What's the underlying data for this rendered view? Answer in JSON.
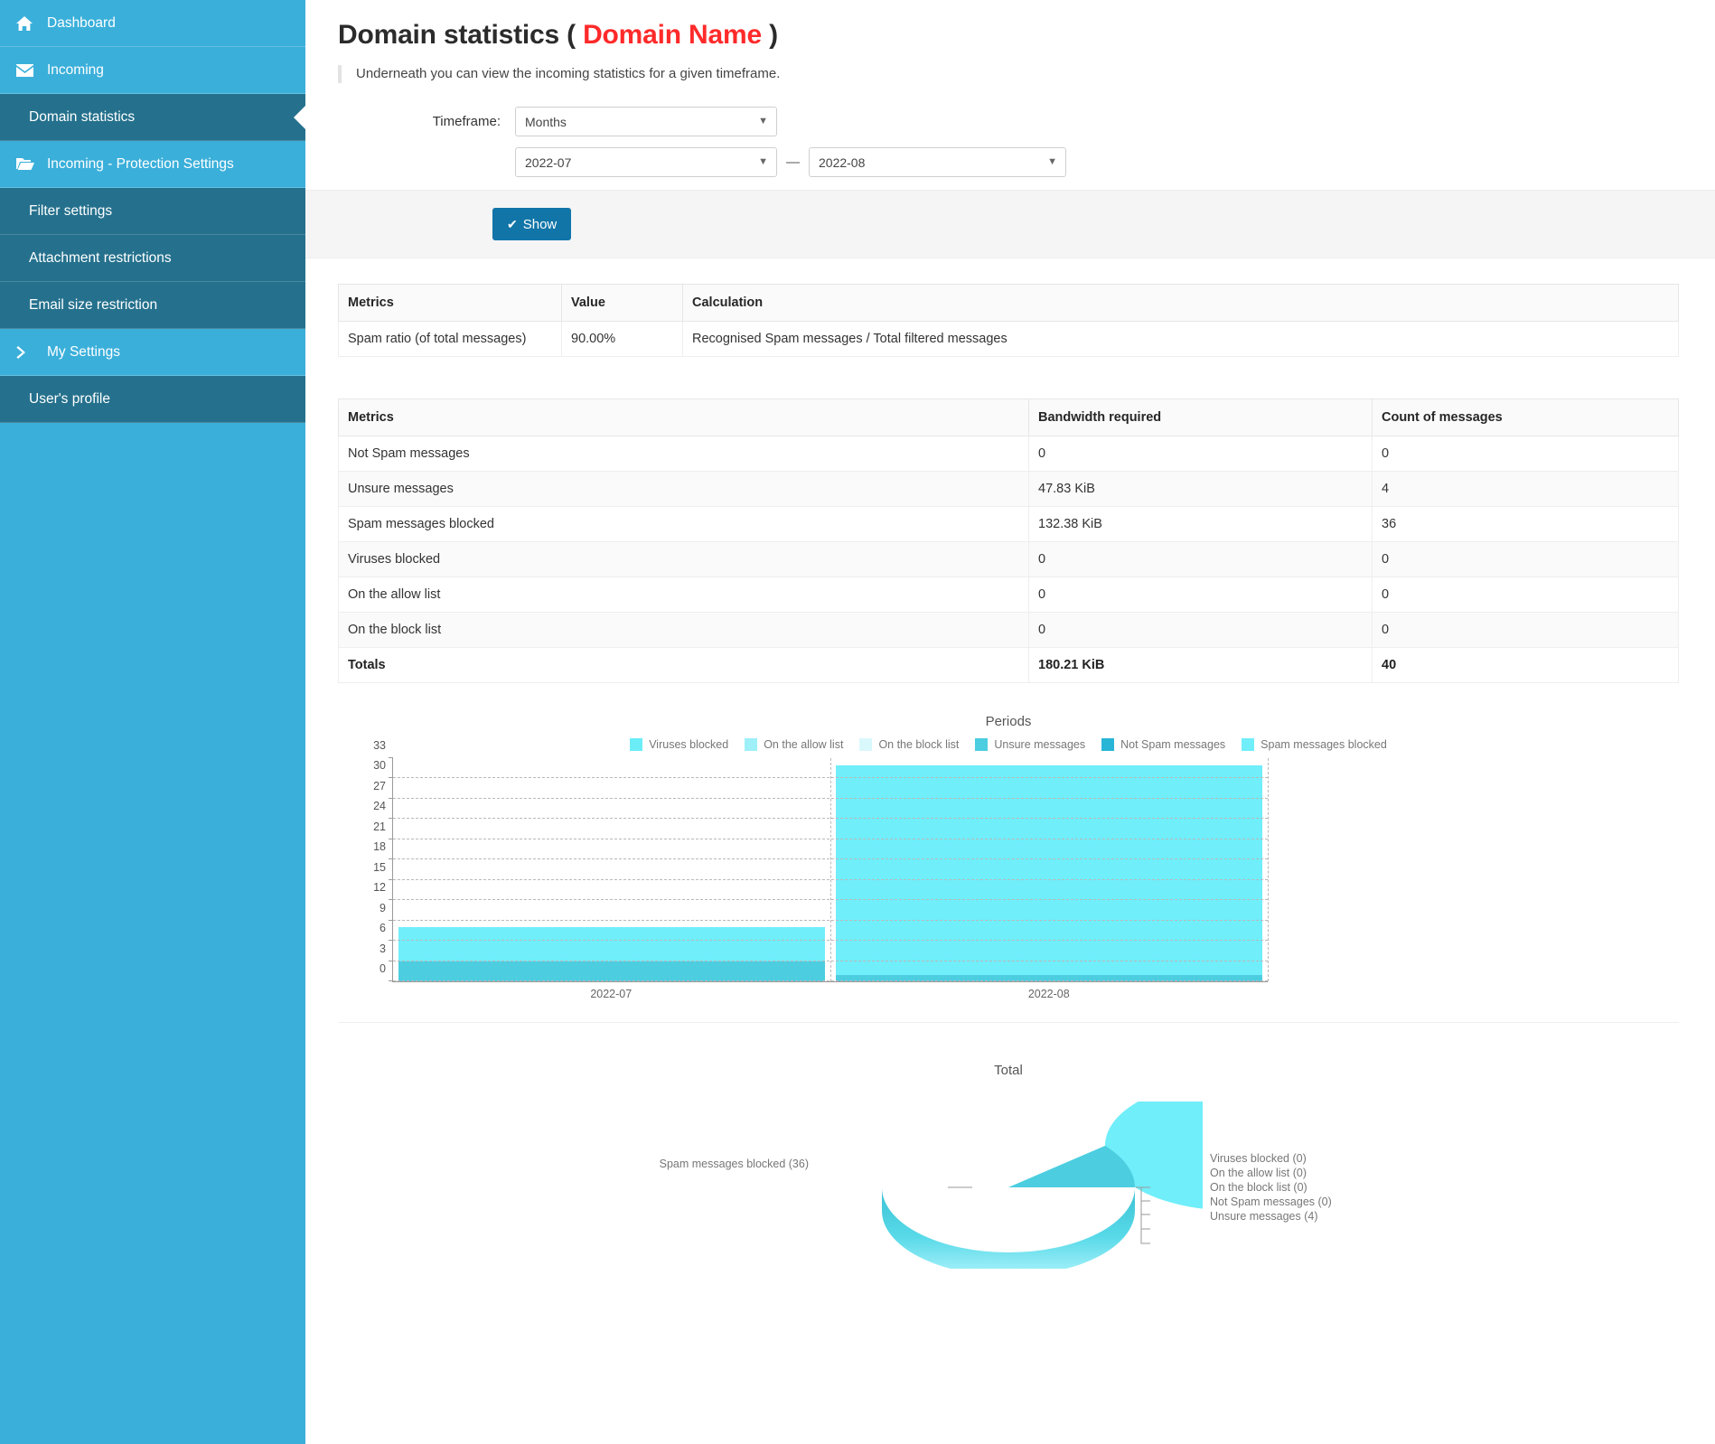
{
  "sidebar": {
    "items": [
      {
        "label": "Dashboard",
        "icon": "home-icon",
        "level": "top",
        "active": false
      },
      {
        "label": "Incoming",
        "icon": "envelope-icon",
        "level": "top",
        "active": false
      },
      {
        "label": "Domain statistics",
        "icon": "none",
        "level": "sub",
        "active": true
      },
      {
        "label": "Incoming - Protection Settings",
        "icon": "folder-open-icon",
        "level": "top",
        "active": false
      },
      {
        "label": "Filter settings",
        "icon": "none",
        "level": "sub",
        "active": false
      },
      {
        "label": "Attachment restrictions",
        "icon": "none",
        "level": "sub",
        "active": false
      },
      {
        "label": "Email size restriction",
        "icon": "none",
        "level": "sub",
        "active": false
      },
      {
        "label": "My Settings",
        "icon": "chevron-right-icon",
        "level": "top",
        "active": false
      },
      {
        "label": "User's profile",
        "icon": "none",
        "level": "sub",
        "active": false
      }
    ],
    "colors": {
      "top_bg": "#3aafda",
      "sub_bg": "#25718d",
      "text": "#ffffff"
    }
  },
  "header": {
    "title_main": "Domain statistics",
    "paren_open": "(",
    "domain_name": "Domain Name",
    "paren_close": ")",
    "domain_color": "#ff2a2a",
    "description": "Underneath you can view the incoming statistics for a given timeframe."
  },
  "form": {
    "timeframe_label": "Timeframe:",
    "timeframe_value": "Months",
    "timeframe_options": [
      "Months"
    ],
    "from_value": "2022-07",
    "from_options": [
      "2022-07"
    ],
    "to_value": "2022-08",
    "to_options": [
      "2022-08"
    ],
    "range_separator": "—",
    "show_button_label": "Show",
    "show_button_icon": "check-icon",
    "show_button_color": "#1175a8"
  },
  "ratio_table": {
    "headers": [
      "Metrics",
      "Value",
      "Calculation"
    ],
    "rows": [
      [
        "Spam ratio (of total messages)",
        "90.00%",
        "Recognised Spam messages / Total filtered messages"
      ]
    ]
  },
  "metrics_table": {
    "headers": [
      "Metrics",
      "Bandwidth required",
      "Count of messages"
    ],
    "rows": [
      [
        "Not Spam messages",
        "0",
        "0"
      ],
      [
        "Unsure messages",
        "47.83 KiB",
        "4"
      ],
      [
        "Spam messages blocked",
        "132.38 KiB",
        "36"
      ],
      [
        "Viruses blocked",
        "0",
        "0"
      ],
      [
        "On the allow list",
        "0",
        "0"
      ],
      [
        "On the block list",
        "0",
        "0"
      ]
    ],
    "totals_row": [
      "Totals",
      "180.21 KiB",
      "40"
    ]
  },
  "chart_data": [
    {
      "type": "bar",
      "title": "Periods",
      "stacked": true,
      "categories": [
        "2022-07",
        "2022-08"
      ],
      "series": [
        {
          "name": "Viruses blocked",
          "values": [
            0,
            0
          ],
          "color": "#6bedf7"
        },
        {
          "name": "On the allow list",
          "values": [
            0,
            0
          ],
          "color": "#9ef0f8"
        },
        {
          "name": "On the block list",
          "values": [
            0,
            0
          ],
          "color": "#d9f8fc"
        },
        {
          "name": "Unsure messages",
          "values": [
            3,
            1
          ],
          "color": "#4ccde0"
        },
        {
          "name": "Not Spam messages",
          "values": [
            0,
            0
          ],
          "color": "#29b5d6"
        },
        {
          "name": "Spam messages blocked",
          "values": [
            5,
            31
          ],
          "color": "#70eefa"
        }
      ],
      "xlabel": "",
      "ylabel": "",
      "ylim": [
        0,
        33
      ],
      "yticks": [
        0,
        3,
        6,
        9,
        12,
        15,
        18,
        21,
        24,
        27,
        30,
        33
      ],
      "grid": true,
      "legend_position": "top"
    },
    {
      "type": "pie",
      "title": "Total",
      "labels": [
        "Spam messages blocked (36)",
        "Viruses blocked (0)",
        "On the allow list (0)",
        "On the block list (0)",
        "Not Spam messages (0)",
        "Unsure messages (4)"
      ],
      "slices": [
        {
          "name": "Spam messages blocked",
          "value": 36,
          "color": "#70eefa"
        },
        {
          "name": "Viruses blocked",
          "value": 0,
          "color": "#6bedf7"
        },
        {
          "name": "On the allow list",
          "value": 0,
          "color": "#9ef0f8"
        },
        {
          "name": "On the block list",
          "value": 0,
          "color": "#d9f8fc"
        },
        {
          "name": "Not Spam messages",
          "value": 0,
          "color": "#29b5d6"
        },
        {
          "name": "Unsure messages",
          "value": 4,
          "color": "#4ccde0"
        }
      ],
      "total": 40,
      "left_label": "Spam messages blocked (36)",
      "right_labels": [
        "Viruses blocked (0)",
        "On the allow list (0)",
        "On the block list (0)",
        "Not Spam messages (0)",
        "Unsure messages (4)"
      ]
    }
  ]
}
